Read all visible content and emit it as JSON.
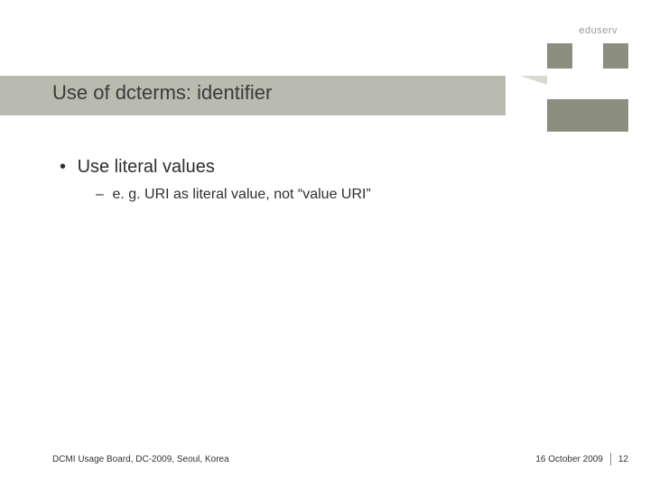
{
  "brand": "eduserv",
  "title": "Use of dcterms: identifier",
  "bullets": {
    "main": "Use literal values",
    "sub": "e. g. URI as literal value, not “value URI”"
  },
  "footer": {
    "left": "DCMI Usage Board, DC-2009, Seoul, Korea",
    "date": "16 October 2009",
    "page": "12"
  }
}
